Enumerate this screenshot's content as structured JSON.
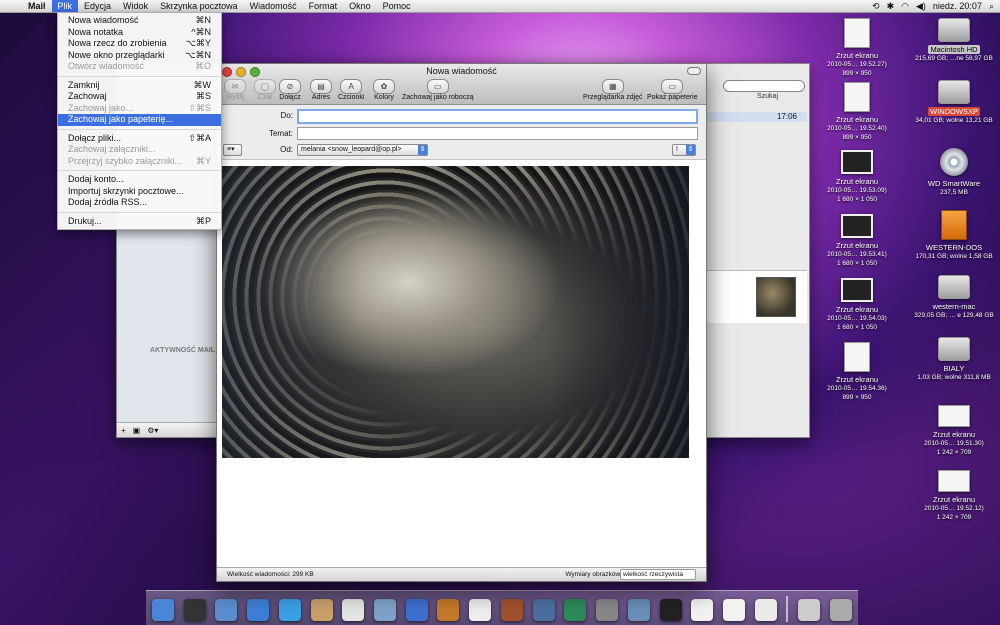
{
  "menubar": {
    "app": "Mail",
    "items": [
      "Plik",
      "Edycja",
      "Widok",
      "Skrzynka pocztowa",
      "Wiadomość",
      "Format",
      "Okno",
      "Pomoc"
    ],
    "active_index": 0,
    "clock": "niedz. 20:07"
  },
  "file_menu": [
    {
      "label": "Nowa wiadomość",
      "shortcut": "⌘N",
      "enabled": true
    },
    {
      "label": "Nowa notatka",
      "shortcut": "^⌘N",
      "enabled": true
    },
    {
      "label": "Nowa rzecz do zrobienia",
      "shortcut": "⌥⌘Y",
      "enabled": true
    },
    {
      "label": "Nowe okno przeglądarki",
      "shortcut": "⌥⌘N",
      "enabled": true
    },
    {
      "label": "Otwórz wiadomość",
      "shortcut": "⌘O",
      "enabled": false
    },
    {
      "sep": true
    },
    {
      "label": "Zamknij",
      "shortcut": "⌘W",
      "enabled": true
    },
    {
      "label": "Zachowaj",
      "shortcut": "⌘S",
      "enabled": true
    },
    {
      "label": "Zachowaj jako...",
      "shortcut": "⇧⌘S",
      "enabled": false
    },
    {
      "label": "Zachowaj jako papeterię...",
      "shortcut": "",
      "enabled": true,
      "highlighted": true
    },
    {
      "sep": true
    },
    {
      "label": "Dołącz pliki...",
      "shortcut": "⇧⌘A",
      "enabled": true
    },
    {
      "label": "Zachowaj załączniki...",
      "shortcut": "",
      "enabled": false
    },
    {
      "label": "Przejrzyj szybko załączniki...",
      "shortcut": "⌘Y",
      "enabled": false
    },
    {
      "sep": true
    },
    {
      "label": "Dodaj konto...",
      "shortcut": "",
      "enabled": true
    },
    {
      "label": "Importuj skrzynki pocztowe...",
      "shortcut": "",
      "enabled": true
    },
    {
      "label": "Dodaj źródła RSS...",
      "shortcut": "",
      "enabled": true
    },
    {
      "sep": true
    },
    {
      "label": "Drukuj...",
      "shortcut": "⌘P",
      "enabled": true
    }
  ],
  "mail_window": {
    "activity_label": "AKTYWNOŚĆ MAIL",
    "search_label": "Szukaj",
    "time": "17:06"
  },
  "compose": {
    "title": "Nowa wiadomość",
    "toolbar": [
      {
        "label": "Wyślij",
        "icon": "send-icon",
        "enabled": false
      },
      {
        "label": "Czat",
        "icon": "chat-icon",
        "enabled": false
      },
      {
        "label": "Dołącz",
        "icon": "paperclip-icon",
        "enabled": true
      },
      {
        "label": "Adres",
        "icon": "address-book-icon",
        "enabled": true
      },
      {
        "label": "Czcionki",
        "icon": "fonts-icon",
        "enabled": true
      },
      {
        "label": "Kolory",
        "icon": "color-wheel-icon",
        "enabled": true
      },
      {
        "label": "Zachowaj jako roboczą",
        "icon": "draft-icon",
        "enabled": true
      },
      {
        "label": "Przeglądarka zdjęć",
        "icon": "photo-browser-icon",
        "enabled": true
      },
      {
        "label": "Pokaż papeterie",
        "icon": "stationery-icon",
        "enabled": true
      }
    ],
    "to_label": "Do:",
    "to_value": "",
    "subject_label": "Temat:",
    "subject_value": "",
    "from_label": "Od:",
    "from_value": "melania <snow_leopard@op.pl>",
    "priority": "!",
    "status_size": "Wielkość wiadomości: 299 KB",
    "image_size_label": "Wymiary obrazków:",
    "image_size_value": "wielkość rzeczywista"
  },
  "desktop_icons": [
    {
      "name": "Zrzut ekranu",
      "sub1": "2010-05… 19.52.27)",
      "sub2": "899 × 950",
      "kind": "doc"
    },
    {
      "name": "Zrzut ekranu",
      "sub1": "2010-05… 19.52.40)",
      "sub2": "899 × 950",
      "kind": "doc"
    },
    {
      "name": "Zrzut ekranu",
      "sub1": "2010-05… 19.53.09)",
      "sub2": "1 680 × 1 050",
      "kind": "screen"
    },
    {
      "name": "Zrzut ekranu",
      "sub1": "2010-05… 19.53.41)",
      "sub2": "1 680 × 1 050",
      "kind": "screen"
    },
    {
      "name": "Zrzut ekranu",
      "sub1": "2010-05… 19.54.03)",
      "sub2": "1 680 × 1 050",
      "kind": "screen"
    },
    {
      "name": "Zrzut ekranu",
      "sub1": "2010-05… 19.54.36)",
      "sub2": "899 × 950",
      "kind": "doc"
    },
    {
      "name": "Macintosh HD",
      "sub1": "215,69 GB; …ne 58,97 GB",
      "sub2": "",
      "kind": "drive"
    },
    {
      "name": "WINDOWSXP",
      "sub1": "34,01 GB; wolne 13,21 GB",
      "sub2": "",
      "kind": "drive"
    },
    {
      "name": "WD SmartWare",
      "sub1": "237,5 MB",
      "sub2": "",
      "kind": "disc"
    },
    {
      "name": "WESTERN-DOS",
      "sub1": "170,31 GB; wolne 1,58 GB",
      "sub2": "",
      "kind": "usb"
    },
    {
      "name": "western-mac",
      "sub1": "329,05 GB; … e 129,48 GB",
      "sub2": "",
      "kind": "drive"
    },
    {
      "name": "BIALY",
      "sub1": "1,03 GB; wolne 311,8 MB",
      "sub2": "",
      "kind": "drive"
    },
    {
      "name": "Zrzut ekranu",
      "sub1": "2010-05… 19.51.30)",
      "sub2": "1 242 × 709",
      "kind": "wide"
    },
    {
      "name": "Zrzut ekranu",
      "sub1": "2010-05… 19.52.12)",
      "sub2": "1 242 × 709",
      "kind": "wide"
    }
  ],
  "dock": [
    "finder-icon",
    "dashboard-icon",
    "mail-stamp-icon",
    "safari-icon",
    "ichat-icon",
    "address-book-icon",
    "ical-icon",
    "iphoto-icon",
    "itunes-icon",
    "image-capture-icon",
    "preview-icon",
    "garageband-icon",
    "spaces-icon",
    "time-machine-icon",
    "system-preferences-icon",
    "photo-icon",
    "x11-icon",
    "document-icon",
    "document-icon",
    "document-icon",
    "separator",
    "downloads-icon",
    "trash-icon"
  ]
}
